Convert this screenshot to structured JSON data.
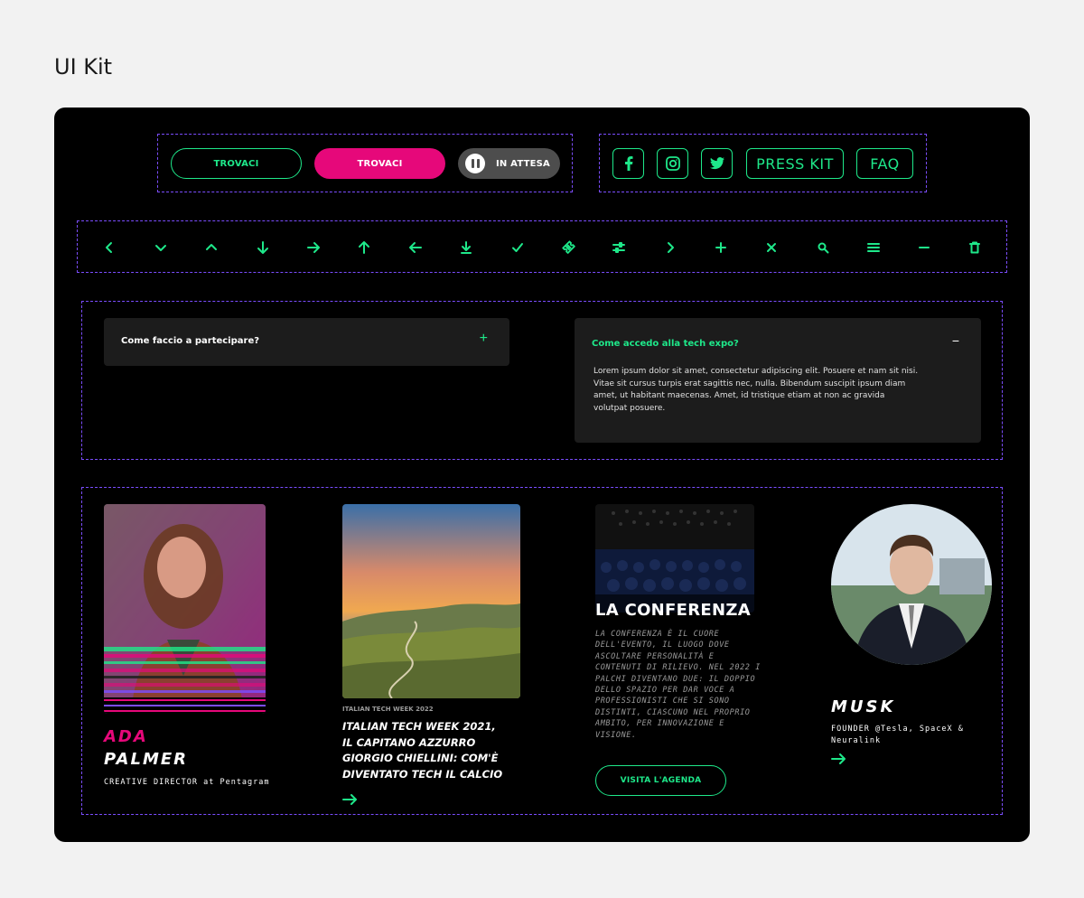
{
  "page_title": "UI Kit",
  "buttons": {
    "outline_label": "TROVACI",
    "pink_label": "TROVACI",
    "pause_label": "IN ATTESA"
  },
  "social": {
    "facebook_icon": "facebook-icon",
    "instagram_icon": "instagram-icon",
    "twitter_icon": "twitter-icon",
    "press_kit_label": "PRESS KIT",
    "faq_label": "FAQ"
  },
  "icons": [
    "chevron-left-icon",
    "chevron-down-icon",
    "chevron-up-icon",
    "arrow-down-icon",
    "arrow-right-icon",
    "arrow-up-icon",
    "arrow-left-icon",
    "download-icon",
    "check-icon",
    "ticket-icon",
    "sliders-icon",
    "chevron-right-icon",
    "plus-icon",
    "close-icon",
    "search-icon",
    "menu-icon",
    "minus-icon",
    "trash-icon"
  ],
  "accordion": {
    "closed_title": "Come faccio a partecipare?",
    "closed_toggle": "+",
    "open_title": "Come accedo alla tech expo?",
    "open_toggle": "−",
    "open_body": "Lorem ipsum dolor sit amet, consectetur adipiscing elit. Posuere et nam sit nisi. Vitae sit cursus turpis erat sagittis nec, nulla. Bibendum suscipit ipsum diam amet, ut habitant maecenas. Amet, id tristique etiam at non ac gravida volutpat posuere."
  },
  "speaker_card": {
    "first_name": "ADA",
    "last_name": "PALMER",
    "role": "CREATIVE DIRECTOR at Pentagram"
  },
  "news_card": {
    "kicker": "ITALIAN TECH WEEK 2022",
    "headline": "ITALIAN TECH WEEK 2021, IL CAPITANO AZZURRO GIORGIO CHIELLINI: COM'È DIVENTATO TECH IL CALCIO"
  },
  "conference_card": {
    "title": "LA CONFERENZA",
    "body": "LA CONFERENZA È IL CUORE DELL'EVENTO, IL LUOGO DOVE ASCOLTARE PERSONALITÀ E CONTENUTI DI RILIEVO. NEL 2022 I PALCHI DIVENTANO DUE: IL DOPPIO DELLO SPAZIO PER DAR VOCE A PROFESSIONISTI CHE SI SONO DISTINTI, CIASCUNO NEL PROPRIO AMBITO, PER INNOVAZIONE E VISIONE.",
    "button_label": "VISITA L'AGENDA"
  },
  "guest_card": {
    "name": "MUSK",
    "role": "FOUNDER @Tesla, SpaceX & Neuralink"
  },
  "colors": {
    "accent_green": "#1ee88a",
    "accent_pink": "#e6087a",
    "guide_purple": "#7b4dff"
  }
}
